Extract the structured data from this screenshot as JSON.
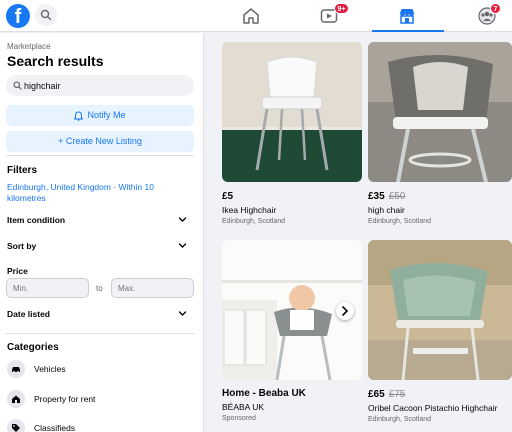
{
  "topbar": {
    "logo_letter": "f",
    "nav": [
      {
        "name": "home-icon"
      },
      {
        "name": "watch-icon",
        "badge": "9+"
      },
      {
        "name": "marketplace-icon",
        "active": true
      },
      {
        "name": "groups-icon",
        "badge": "7"
      }
    ]
  },
  "sidebar": {
    "breadcrumb": "Marketplace",
    "title": "Search results",
    "search": {
      "value": "highchair",
      "placeholder": "Search Marketplace"
    },
    "notify_label": "Notify Me",
    "create_label": "+ Create New Listing",
    "filters_heading": "Filters",
    "location_filter": "Edinburgh, United Kingdom · Within 10 kilometres",
    "filter_rows": [
      "Item condition",
      "Sort by",
      "Price",
      "Date listed"
    ],
    "price": {
      "label": "Price",
      "min_placeholder": "Min.",
      "to": "to",
      "max_placeholder": "Max."
    },
    "categories_heading": "Categories",
    "categories": [
      {
        "label": "Vehicles",
        "icon": "car-icon"
      },
      {
        "label": "Property for rent",
        "icon": "house-icon"
      },
      {
        "label": "Classifieds",
        "icon": "tag-icon"
      }
    ]
  },
  "listings": [
    {
      "price": "£5",
      "old_price": "",
      "title": "Ikea Highchair",
      "location": "Edinburgh, Scotland"
    },
    {
      "price": "£35",
      "old_price": "£50",
      "title": "high chair",
      "location": "Edinburgh, Scotland"
    },
    {
      "price": "Home - Beaba UK",
      "old_price": "",
      "title": "BÉABA UK",
      "location": "Sponsored"
    },
    {
      "price": "£65",
      "old_price": "£75",
      "title": "Oribel Cacoon Pistachio Highchair",
      "location": "Edinburgh, Scotland"
    }
  ],
  "colors": {
    "accent": "#1877f2",
    "badge": "#e41e3f",
    "page_bg": "#f0f2f5"
  }
}
